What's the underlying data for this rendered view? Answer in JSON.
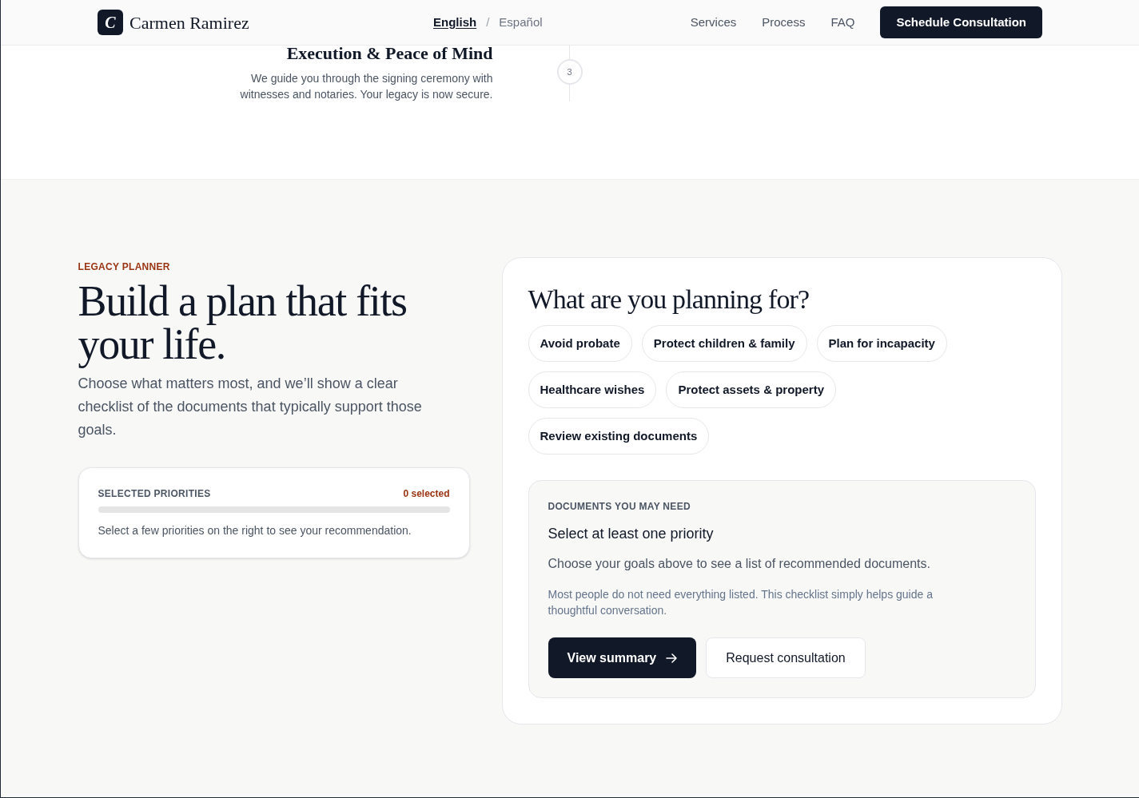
{
  "header": {
    "logo_letter": "C",
    "brand": "Carmen Ramirez",
    "languages": [
      {
        "label": "English",
        "selected": true
      },
      {
        "label": "Español",
        "selected": false
      }
    ],
    "language_separator": "/",
    "nav": [
      "Services",
      "Process",
      "FAQ"
    ],
    "cta": "Schedule Consultation"
  },
  "process_step": {
    "title": "Execution & Peace of Mind",
    "description": "We guide you through the signing ceremony with witnesses and notaries. Your legacy is now secure.",
    "number": "3"
  },
  "planner": {
    "eyebrow": "LEGACY PLANNER",
    "heading": "Build a plan that fits your life.",
    "intro": "Choose what matters most, and we’ll show a clear checklist of the documents that typically support those goals.",
    "priorities_card": {
      "label": "SELECTED PRIORITIES",
      "count": "0 selected",
      "level": 0,
      "hint": "Select a few priorities on the right to see your recommendation."
    },
    "question": "What are you planning for?",
    "options": [
      {
        "label": "Avoid probate",
        "selected": false
      },
      {
        "label": "Protect children & family",
        "selected": false
      },
      {
        "label": "Plan for incapacity",
        "selected": false
      },
      {
        "label": "Healthcare wishes",
        "selected": false
      },
      {
        "label": "Protect assets & property",
        "selected": false
      },
      {
        "label": "Review existing documents",
        "selected": false
      }
    ],
    "documents": {
      "label": "DOCUMENTS YOU MAY NEED",
      "title": "Select at least one priority",
      "description": "Choose your goals above to see a list of recommended documents.",
      "note": "Most people do not need everything listed. This checklist simply helps guide a thoughtful conversation.",
      "primary_button": "View summary",
      "secondary_button": "Request consultation"
    }
  }
}
